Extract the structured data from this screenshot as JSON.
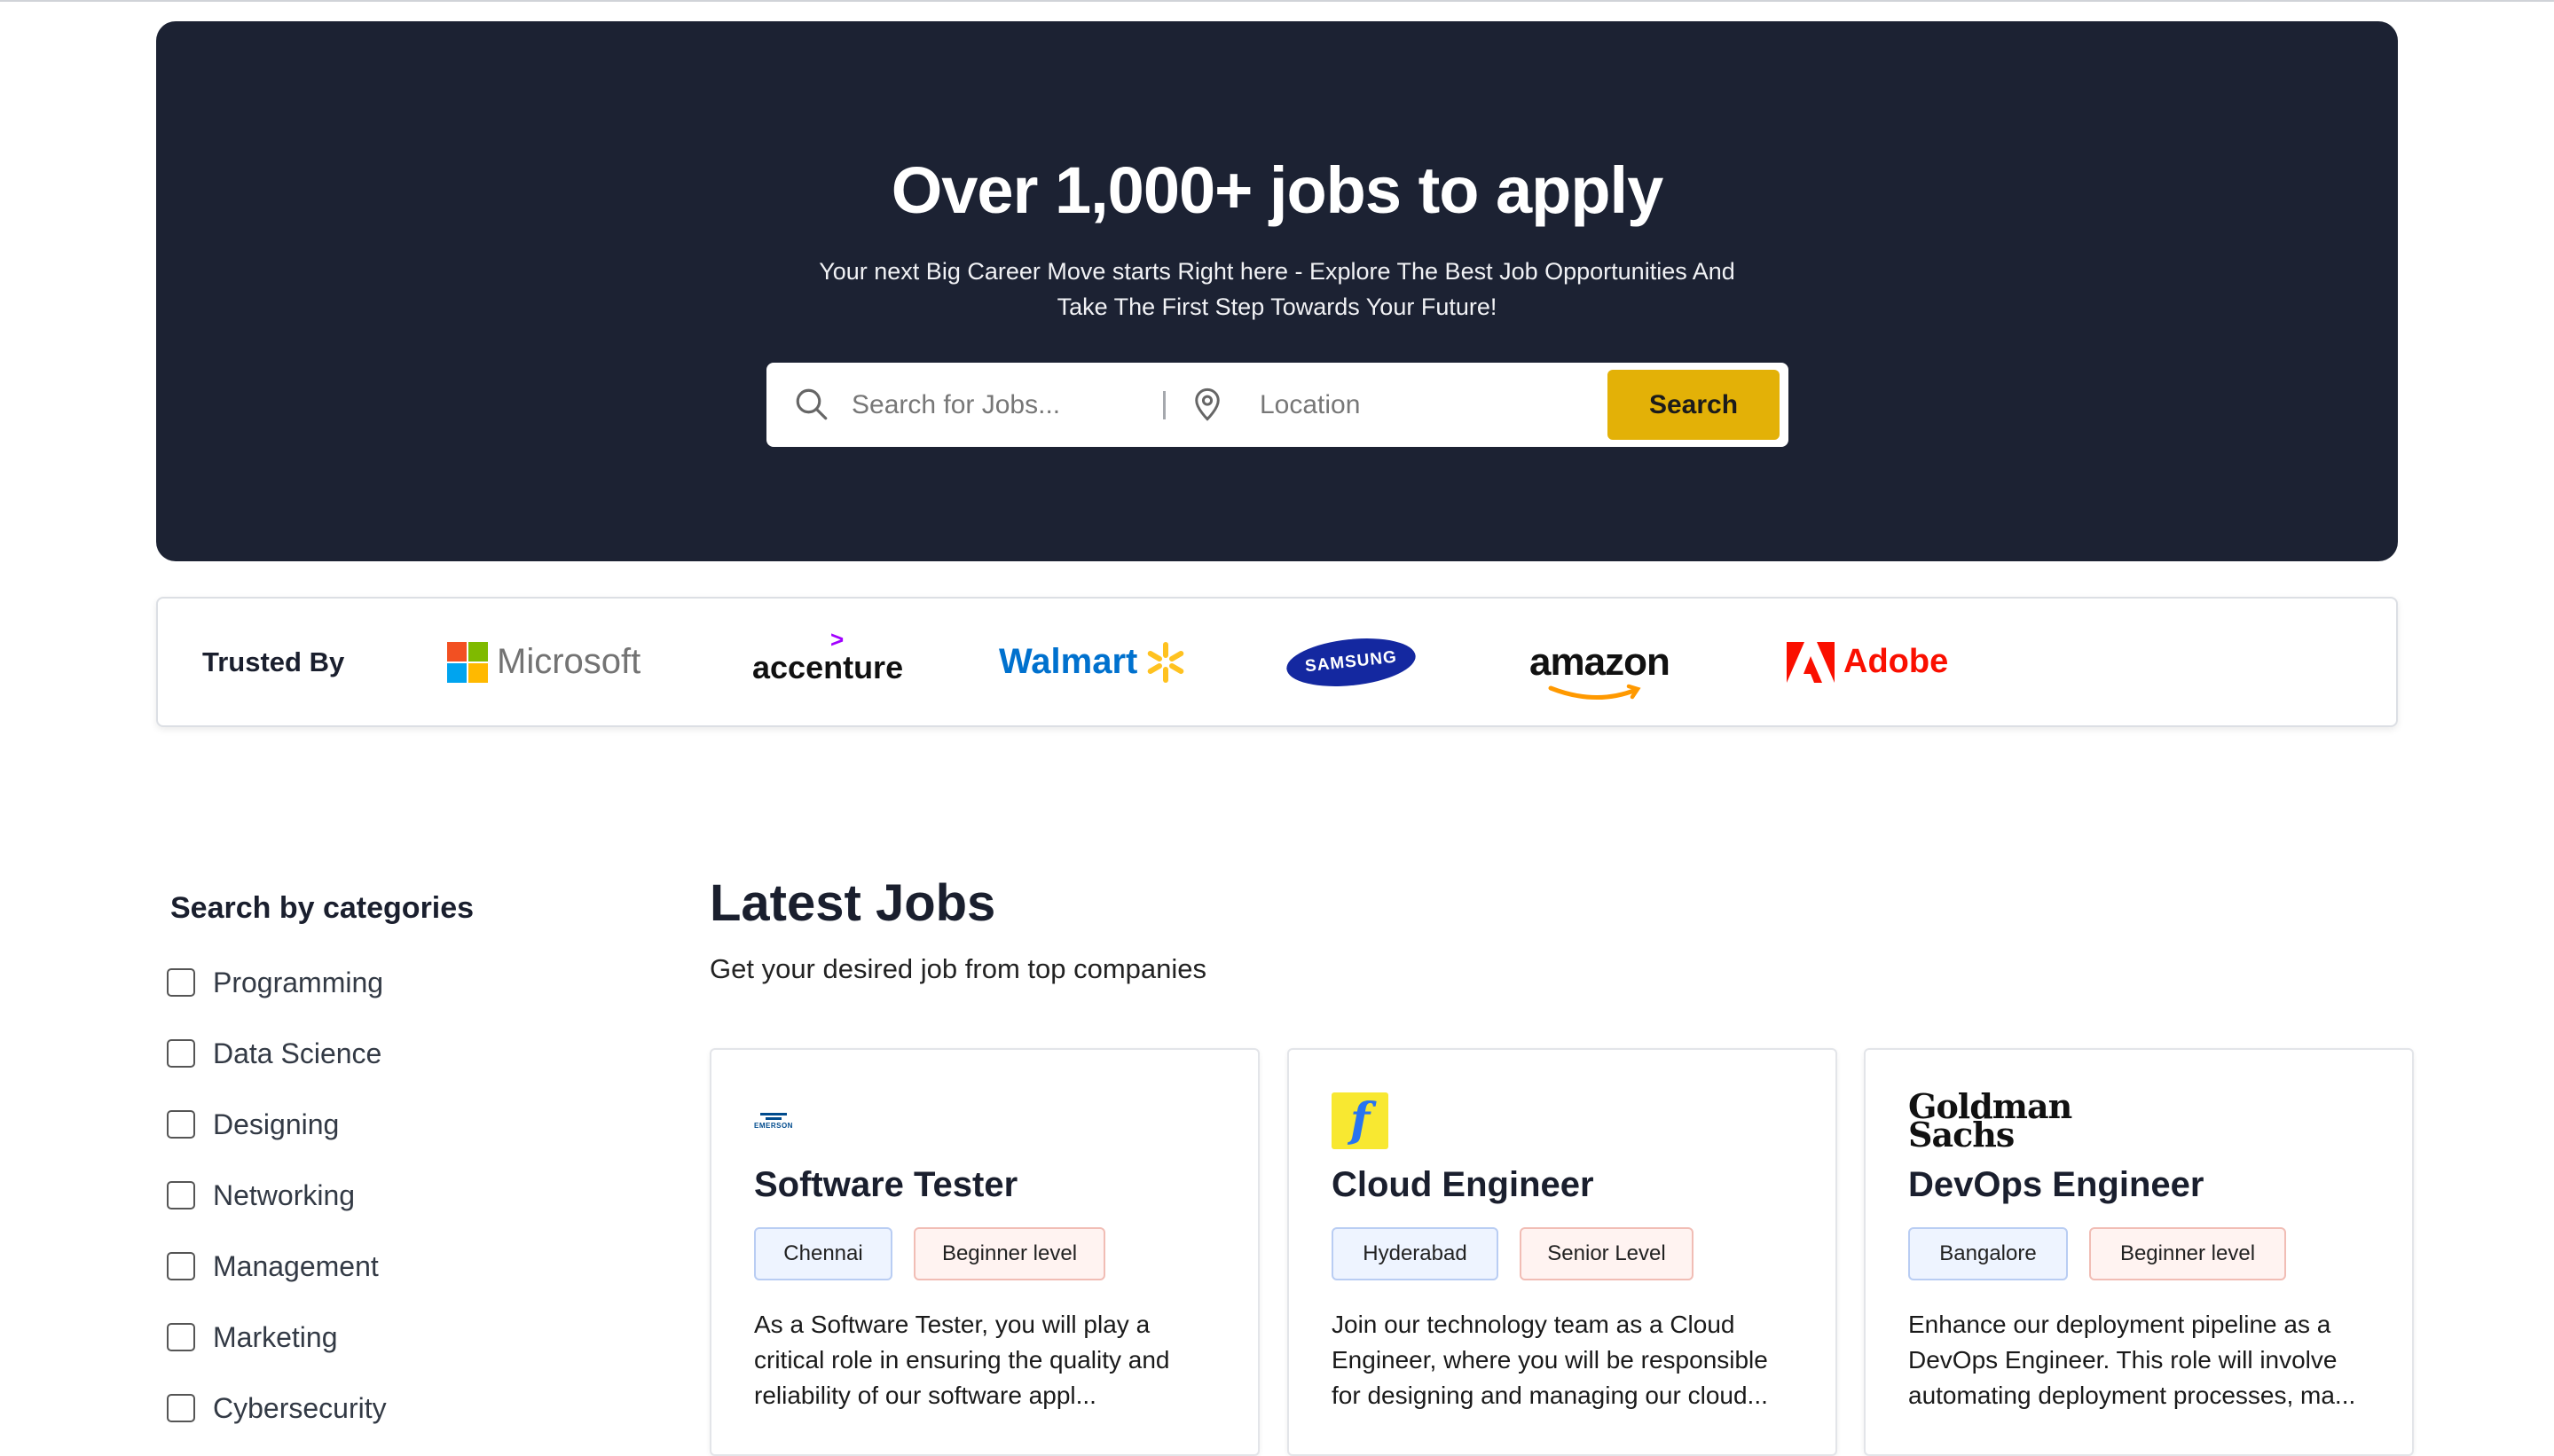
{
  "hero": {
    "title": "Over 1,000+ jobs to apply",
    "subtitle_line1": "Your next Big Career Move starts Right here - Explore The Best Job Opportunities And",
    "subtitle_line2": "Take The First Step Towards Your Future!",
    "search_placeholder": "Search for Jobs...",
    "location_placeholder": "Location",
    "search_button": "Search",
    "accent_color": "#e3b107",
    "background_color": "#1c2233"
  },
  "trusted": {
    "label": "Trusted By",
    "logos": {
      "microsoft": "Microsoft",
      "accenture": "accenture",
      "walmart": "Walmart",
      "samsung": "SAMSUNG",
      "amazon": "amazon",
      "adobe": "Adobe"
    }
  },
  "categories": {
    "title": "Search by categories",
    "items": [
      "Programming",
      "Data Science",
      "Designing",
      "Networking",
      "Management",
      "Marketing",
      "Cybersecurity"
    ]
  },
  "jobs": {
    "title": "Latest Jobs",
    "subtitle": "Get your desired job from top companies",
    "cards": [
      {
        "company_logo": "EMERSON",
        "title": "Software Tester",
        "location": "Chennai",
        "level": "Beginner level",
        "description_line1": "As a Software Tester, you will play a",
        "description_line2": "critical role in ensuring the quality and",
        "description_line3": "reliability of our software appl..."
      },
      {
        "company_logo": "f",
        "title": "Cloud Engineer",
        "location": "Hyderabad",
        "level": "Senior Level",
        "description_line1": "Join our technology team as a Cloud",
        "description_line2": "Engineer, where you will be responsible",
        "description_line3": "for designing and managing our cloud..."
      },
      {
        "company_logo_line1": "Goldman",
        "company_logo_line2": "Sachs",
        "title": "DevOps Engineer",
        "location": "Bangalore",
        "level": "Beginner level",
        "description_line1": "Enhance our deployment pipeline as a",
        "description_line2": "DevOps Engineer. This role will involve",
        "description_line3": "automating deployment processes, ma..."
      }
    ]
  }
}
